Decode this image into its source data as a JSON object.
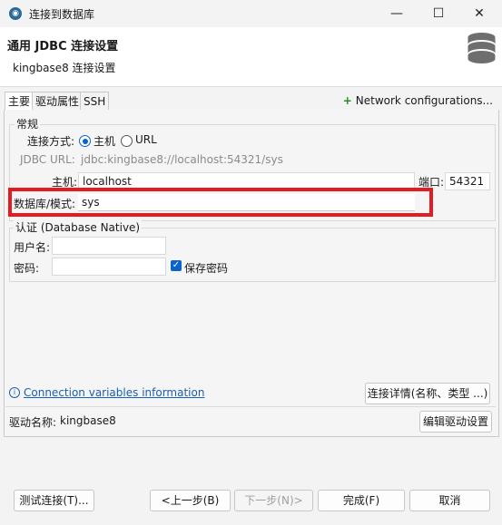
{
  "window": {
    "title": "连接到数据库",
    "minimize": "—",
    "maximize": "☐",
    "close": "✕"
  },
  "header": {
    "title": "通用 JDBC 连接设置",
    "subtitle": "kingbase8 连接设置"
  },
  "tabs": [
    {
      "label": "主要"
    },
    {
      "label": "驱动属性"
    },
    {
      "label": "SSH"
    }
  ],
  "network_config": {
    "plus": "+",
    "label": "Network configurations..."
  },
  "general": {
    "group_label": "常规",
    "connect_method_label": "连接方式:",
    "option_host": "主机",
    "option_url": "URL",
    "jdbc_url_label": "JDBC URL:",
    "jdbc_url_value": "jdbc:kingbase8://localhost:54321/sys",
    "host_label": "主机:",
    "host_value": "localhost",
    "port_label": "端口:",
    "port_value": "54321",
    "db_label": "数据库/模式:",
    "db_value": "sys"
  },
  "auth": {
    "group_label": "认证 (Database Native)",
    "user_label": "用户名:",
    "user_value": "",
    "password_label": "密码:",
    "password_value": "",
    "save_password_label": "保存密码",
    "save_password_checked": true
  },
  "info": {
    "icon": "i",
    "conn_vars_link": "Connection variables information",
    "details_button": "连接详情(名称、类型 ...)"
  },
  "driver": {
    "label": "驱动名称:",
    "value": "kingbase8",
    "edit_button": "编辑驱动设置"
  },
  "footer": {
    "test_button": "测试连接(T)...",
    "back_button": "<上一步(B)",
    "next_button": "下一步(N)>",
    "finish_button": "完成(F)",
    "cancel_button": "取消"
  },
  "colors": {
    "highlight_border": "#e31b23",
    "accent": "#0a63c9",
    "link": "#1a5fb4"
  }
}
